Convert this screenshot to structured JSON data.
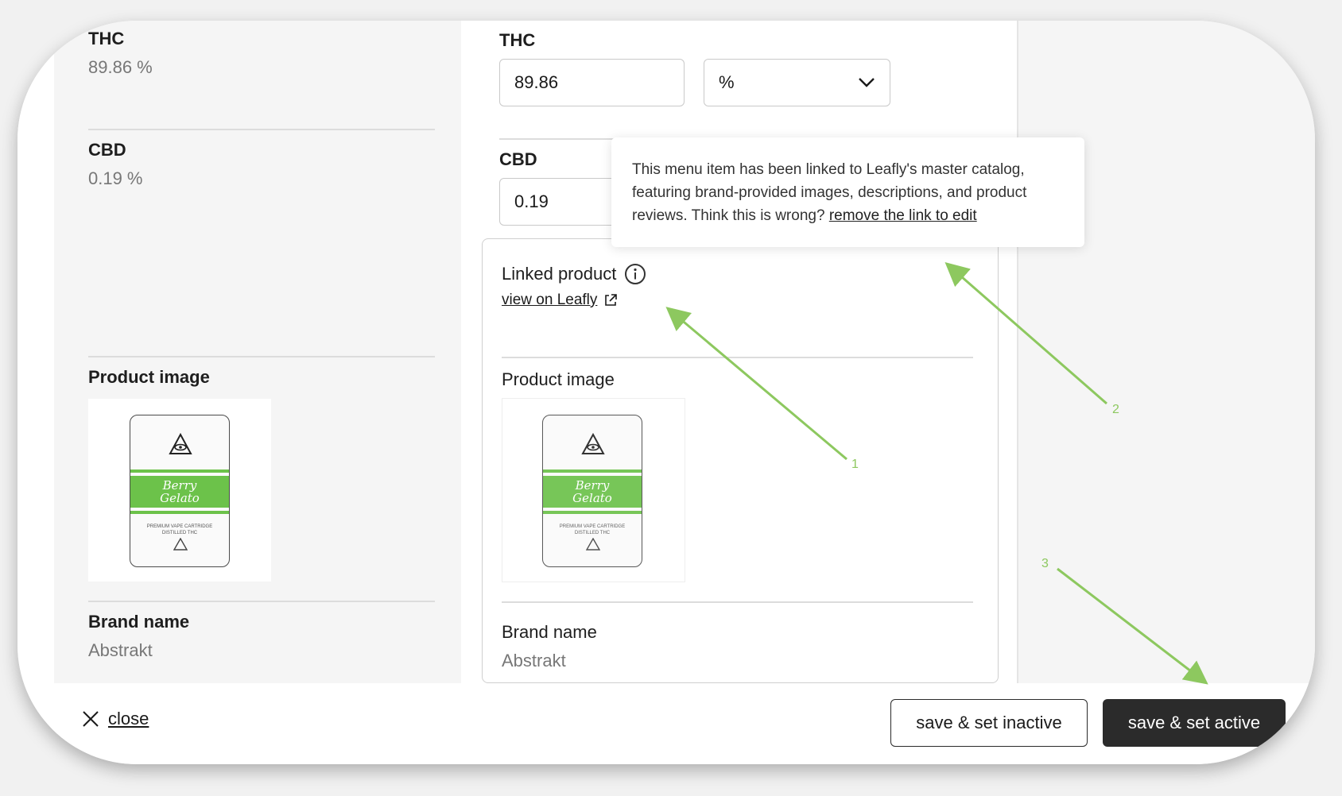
{
  "left_panel": {
    "thc": {
      "label": "THC",
      "value": "89.86 %"
    },
    "cbd": {
      "label": "CBD",
      "value": "0.19 %"
    },
    "product_image_label": "Product image",
    "brand": {
      "label": "Brand name",
      "value": "Abstrakt"
    }
  },
  "middle_panel": {
    "thc": {
      "label": "THC",
      "input_value": "89.86",
      "unit_selected": "%"
    },
    "cbd": {
      "label": "CBD",
      "input_value": "0.19"
    },
    "linked_product": {
      "title": "Linked product",
      "link_text": "view on Leafly",
      "product_image_label": "Product image",
      "brand": {
        "label": "Brand name",
        "value": "Abstrakt"
      }
    }
  },
  "tooltip": {
    "text": "This menu item has been linked to Leafly's master catalog, featuring brand-provided images, descriptions, and product reviews. Think this is wrong? ",
    "link_text": "remove the link to edit"
  },
  "footer": {
    "close_label": "close",
    "inactive_button": "save & set inactive",
    "active_button": "save & set active"
  },
  "annotations": {
    "labels": [
      "1",
      "2",
      "3"
    ],
    "color": "#8dc85f"
  },
  "icons": [
    "info-icon",
    "external-link-icon",
    "chevron-down-icon",
    "close-icon"
  ]
}
